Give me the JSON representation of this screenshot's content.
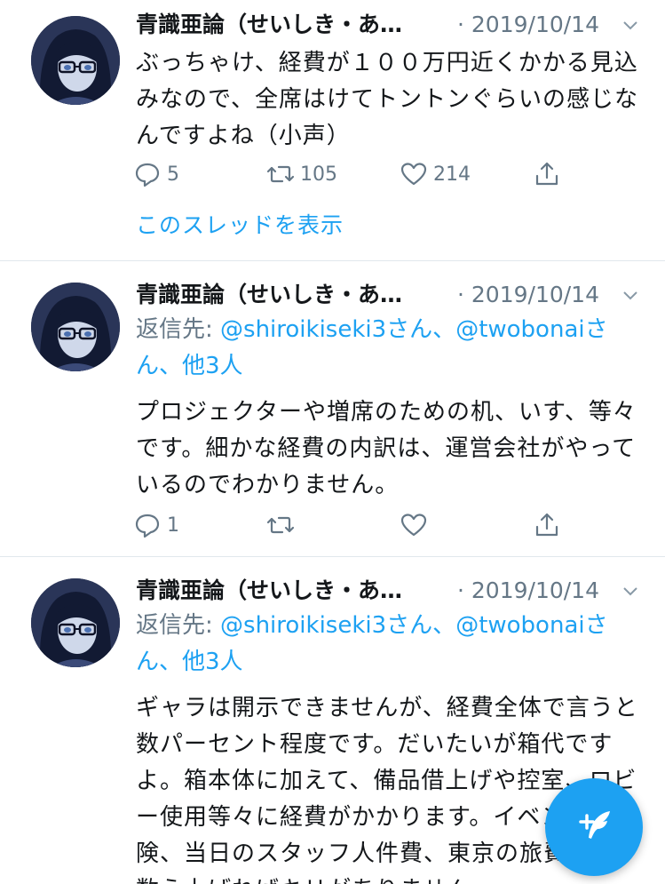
{
  "tweets": [
    {
      "name": "青識亜論（せいしき・あ…",
      "date": "· 2019/10/14",
      "text": "ぶっちゃけ、経費が１００万円近くかかる見込みなので、全席はけてトントンぐらいの感じなんですよね（小声）",
      "reply_count": "5",
      "retweet_count": "105",
      "like_count": "214",
      "thread_link": "このスレッドを表示"
    },
    {
      "name": "青識亜論（せいしき・あ…",
      "date": "· 2019/10/14",
      "reply_prefix": "返信先: ",
      "mention1": "@shiroikiseki3さん、",
      "mention2": "@twobonaiさん、他3人",
      "text": "プロジェクターや増席のための机、いす、等々です。細かな経費の内訳は、運営会社がやっているのでわかりません。",
      "reply_count": "1",
      "retweet_count": "",
      "like_count": ""
    },
    {
      "name": "青識亜論（せいしき・あ…",
      "date": "· 2019/10/14",
      "reply_prefix": "返信先: ",
      "mention1": "@shiroikiseki3さん、",
      "mention2": "@twobonaiさん、他3人",
      "text": "ギャラは開示できませんが、経費全体で言うと数パーセント程度です。だいたいが箱代ですよ。箱本体に加えて、備品借上げや控室、ロビー使用等々に経費がかかります。イベント保険、当日のスタッフ人件費、東京の旅費等々、数え上げればキリがありません。"
    }
  ],
  "icons": {
    "chevron": "chevron-down-icon",
    "reply": "reply-icon",
    "retweet": "retweet-icon",
    "like": "heart-icon",
    "share": "share-icon",
    "compose": "compose-tweet-icon"
  },
  "colors": {
    "accent": "#1da1f2",
    "muted": "#657786",
    "divider": "#e1e8ed"
  }
}
